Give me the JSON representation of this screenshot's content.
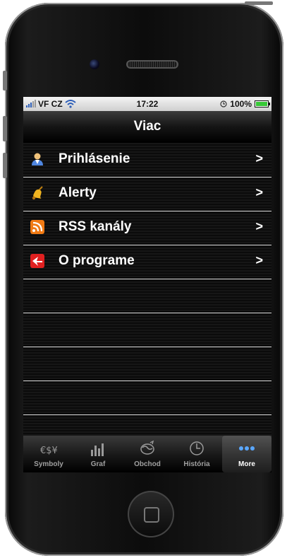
{
  "status_bar": {
    "carrier": "VF CZ",
    "time": "17:22",
    "battery_percent": "100%",
    "icons": [
      "signal-bars-icon",
      "wifi-icon",
      "clock-icon",
      "battery-icon"
    ]
  },
  "nav": {
    "title": "Viac"
  },
  "menu": {
    "items": [
      {
        "label": "Prihlásenie",
        "icon": "user-icon"
      },
      {
        "label": "Alerty",
        "icon": "bell-icon"
      },
      {
        "label": "RSS kanály",
        "icon": "rss-icon"
      },
      {
        "label": "O programe",
        "icon": "app-logo-icon"
      }
    ]
  },
  "tabs": [
    {
      "label": "Symboly",
      "icon": "currency-symbols-icon",
      "selected": false
    },
    {
      "label": "Graf",
      "icon": "bar-chart-icon",
      "selected": false
    },
    {
      "label": "Obchod",
      "icon": "globe-icon",
      "selected": false
    },
    {
      "label": "História",
      "icon": "clock-icon",
      "selected": false
    },
    {
      "label": "More",
      "icon": "more-dots-icon",
      "selected": true
    }
  ],
  "colors": {
    "accent_blue": "#5aa7ff",
    "rss_orange": "#f07a14",
    "logo_red": "#e02020",
    "battery_green": "#37c837"
  }
}
